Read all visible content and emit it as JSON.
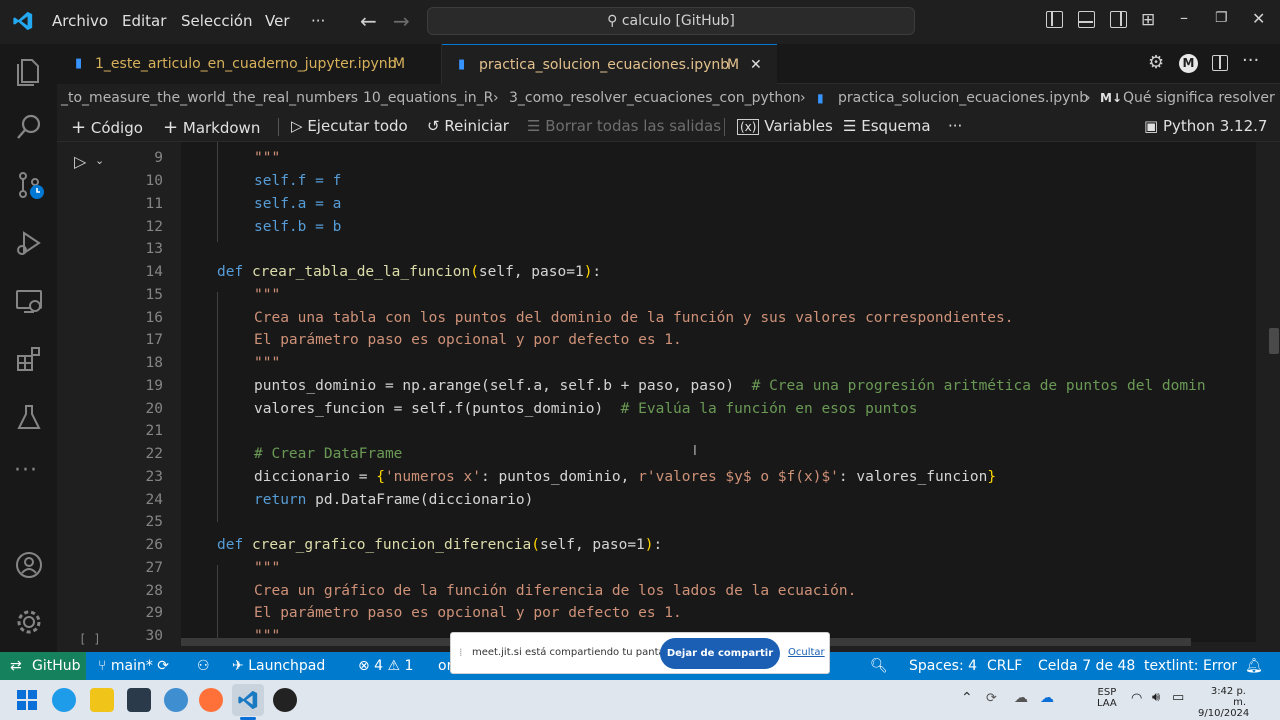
{
  "menu": {
    "archivo": "Archivo",
    "editar": "Editar",
    "seleccion": "Selección",
    "ver": "Ver",
    "more": "···"
  },
  "command_center": "calculo [GitHub]",
  "tabs": [
    {
      "label": "1_este_articulo_en_cuaderno_jupyter.ipynb",
      "badge": "M"
    },
    {
      "label": "practica_solucion_ecuaciones.ipynb",
      "badge": "M",
      "close": "✕"
    }
  ],
  "breadcrumb": {
    "p1": "_to_measure_the_world_the_real_numbers",
    "p2": "10_equations_in_R",
    "p3": "3_como_resolver_ecuaciones_con_python",
    "p4": "practica_solucion_ecuaciones.ipynb",
    "p5_tag": "M↓",
    "p5": "Qué significa resolver u"
  },
  "toolbar": {
    "codigo": "Código",
    "markdown": "Markdown",
    "ejecutar": "Ejecutar todo",
    "reiniciar": "Reiniciar",
    "borrar": "Borrar todas las salidas",
    "variables": "Variables",
    "esquema": "Esquema",
    "more": "···",
    "kernel": "Python 3.12.7"
  },
  "cell_status": "[ ]",
  "code": {
    "l9": "\"\"\"",
    "l10": "self.f = f",
    "l11": "self.a = a",
    "l12": "self.b = b",
    "l14_kw": "def",
    "l14_fn": "crear_tabla_de_la_funcion",
    "l14_args": "self, paso=1",
    "l15": "\"\"\"",
    "l16": "Crea una tabla con los puntos del dominio de la función y sus valores correspondientes.",
    "l17": "El parámetro paso es opcional y por defecto es 1.",
    "l18": "\"\"\"",
    "l19_code": "puntos_dominio = np.arange(self.a, self.b + paso, paso)",
    "l19_cm": "# Crea una progresión aritmética de puntos del domin",
    "l20_code": "valores_funcion = self.f(puntos_dominio)",
    "l20_cm": "# Evalúa la función en esos puntos",
    "l22": "# Crear DataFrame",
    "l23_a": "diccionario = ",
    "l23_s1": "'numeros x'",
    "l23_b": ": puntos_dominio, ",
    "l23_s2": "r'valores $y$ o $f(x)$'",
    "l23_c": ": valores_funcion",
    "l24_kw": "return",
    "l24_code": "pd.DataFrame(diccionario)",
    "l26_kw": "def",
    "l26_fn": "crear_grafico_funcion_diferencia",
    "l26_args": "self, paso=1",
    "l27": "\"\"\"",
    "l28": "Crea un gráfico de la función diferencia de los lados de la ecuación.",
    "l29": "El parámetro paso es opcional y por defecto es 1.",
    "l30": "\"\"\""
  },
  "line_numbers": [
    "9",
    "10",
    "11",
    "12",
    "13",
    "14",
    "15",
    "16",
    "17",
    "18",
    "19",
    "20",
    "21",
    "22",
    "23",
    "24",
    "25",
    "26",
    "27",
    "28",
    "29",
    "30"
  ],
  "status": {
    "github": "GitHub",
    "branch": "main*",
    "launchpad": "Launchpad",
    "problems": "⊗ 4 ⚠ 1",
    "spaces": "Spaces: 4",
    "eol": "CRLF",
    "cell": "Celda 7 de 48",
    "textlint": "textlint: Error"
  },
  "share": {
    "message": "meet.jit.si está compartiendo tu pantalla.",
    "stop": "Dejar de compartir",
    "hide": "Ocultar"
  },
  "taskbar": {
    "lang1": "ESP",
    "lang2": "LAA",
    "time": "3:42 p. m.",
    "date": "9/10/2024"
  },
  "colors": {
    "accent": "#007acc",
    "remote": "#16825d",
    "keyword": "#569cd6",
    "function": "#dcdcaa",
    "string": "#ce9178",
    "comment": "#6a9955"
  }
}
